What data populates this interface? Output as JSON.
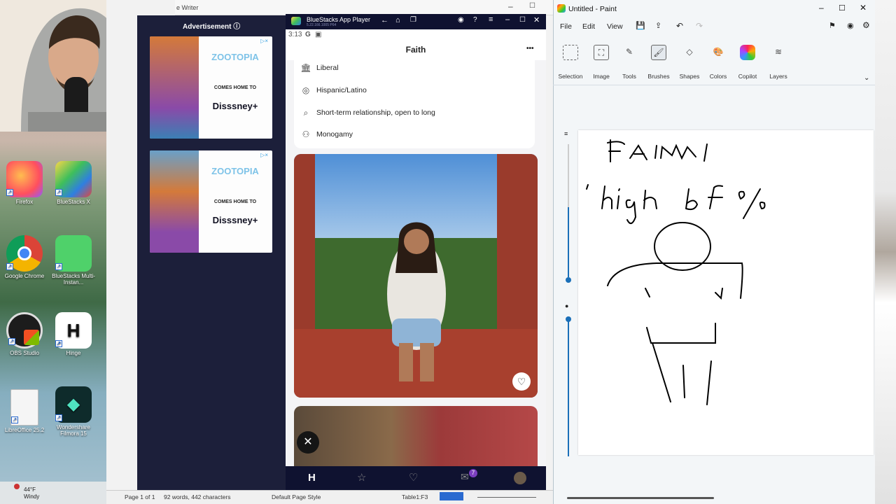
{
  "desktop": {
    "icons": [
      {
        "label": "Firefox",
        "color": "#ff7139"
      },
      {
        "label": "BlueStacks X",
        "color": "#3aa74a"
      },
      {
        "label": "Google Chrome",
        "color": "#1e88e5"
      },
      {
        "label": "BlueStacks Multi-Instan...",
        "color": "#56d364"
      },
      {
        "label": "OBS Studio",
        "color": "#222"
      },
      {
        "label": "Hinge",
        "color": "#fff"
      },
      {
        "label": "LibreOffice 25.2",
        "color": "#f5f5f5"
      },
      {
        "label": "Wondershare Filmora 15",
        "color": "#0e2b2b"
      }
    ],
    "weather": {
      "temp": "44°F",
      "desc": "Windy"
    }
  },
  "writer": {
    "title": "e Writer",
    "ad_label": "Advertisement",
    "ad_brand": "ZOOTOPIA",
    "ad_sub": "COMES HOME TO",
    "ad_stream": "Disssney+",
    "status": {
      "page": "Page 1 of 1",
      "words": "92 words, 442 characters",
      "style": "Default Page Style",
      "table": "Table1:F3"
    }
  },
  "bluestacks": {
    "app_title": "BlueStacks App Player",
    "version": "5.22.166.1005 P64",
    "time": "3:13",
    "profile": {
      "name": "Faith",
      "menu": "•••",
      "info": [
        {
          "icon": "🏛",
          "text": "Liberal"
        },
        {
          "icon": "◎",
          "text": "Hispanic/Latino"
        },
        {
          "icon": "⌕",
          "text": "Short-term relationship, open to long"
        },
        {
          "icon": "⚇",
          "text": "Monogamy"
        }
      ]
    },
    "nav_badge": "7"
  },
  "paint": {
    "title": "Untitled - Paint",
    "menu": [
      "File",
      "Edit",
      "View"
    ],
    "tools": [
      "Selection",
      "Image",
      "Tools",
      "Brushes",
      "Shapes",
      "Colors",
      "Copilot",
      "Layers"
    ]
  }
}
